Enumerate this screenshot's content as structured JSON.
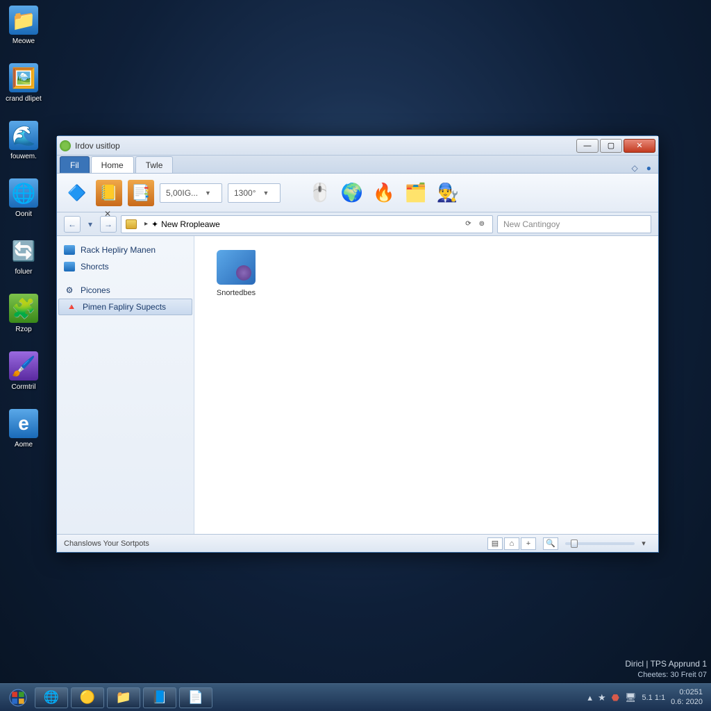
{
  "desktop_icons": [
    {
      "label": "Meowe"
    },
    {
      "label": "crand dlipet"
    },
    {
      "label": "fouwem."
    },
    {
      "label": "Oonit"
    },
    {
      "label": "foluer"
    },
    {
      "label": "Rzop"
    },
    {
      "label": "Cormtril"
    },
    {
      "label": "Aome"
    }
  ],
  "window": {
    "title": "Irdov usitlop",
    "tabs": {
      "file": "Fil",
      "home": "Home",
      "twle": "Twle"
    },
    "ribbon": {
      "combo1": "5,00IG...",
      "combo2": "1300°"
    },
    "address": {
      "path": "New Rropleawe"
    },
    "search_placeholder": "New Cantingoy",
    "sidebar": {
      "items": [
        "Rack Hepliry Manen",
        "Shorcts",
        "Picones",
        "Pimen Fapliry Supects"
      ]
    },
    "content": {
      "item0": "Snortedbes"
    },
    "status": "Chanslows Your Sortpots"
  },
  "watermark": {
    "line1": "Diricl | TPS Apprund 1",
    "line2": "Cheetes: 30 Freit 07"
  },
  "taskbar": {
    "clock_time": "0:0251",
    "clock_date": "0.6: 2020",
    "tray_text": "5.1 1:1"
  }
}
